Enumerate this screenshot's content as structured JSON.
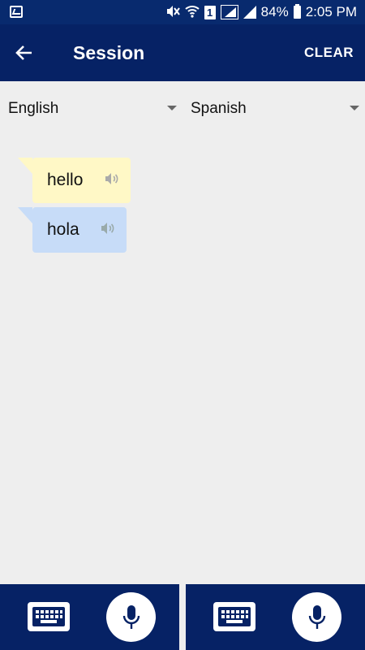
{
  "status_bar": {
    "battery_percent": "84%",
    "time": "2:05 PM",
    "sim_slot": "1",
    "icons": [
      "gallery-icon",
      "mute-icon",
      "wifi-icon",
      "sim-icon",
      "signal-icon",
      "signal-icon",
      "battery-icon"
    ]
  },
  "app_bar": {
    "title": "Session",
    "clear_label": "CLEAR",
    "back_icon": "arrow-left-icon"
  },
  "languages": {
    "source": "English",
    "target": "Spanish"
  },
  "messages": [
    {
      "text": "hello",
      "lang": "source",
      "color": "#fff8c6"
    },
    {
      "text": "hola",
      "lang": "target",
      "color": "#c7dcf8"
    }
  ],
  "bottom_bar": {
    "left": {
      "keyboard_icon": "keyboard-icon",
      "mic_icon": "microphone-icon"
    },
    "right": {
      "keyboard_icon": "keyboard-icon",
      "mic_icon": "microphone-icon"
    }
  },
  "colors": {
    "primary": "#062265",
    "background": "#eeeeee"
  }
}
